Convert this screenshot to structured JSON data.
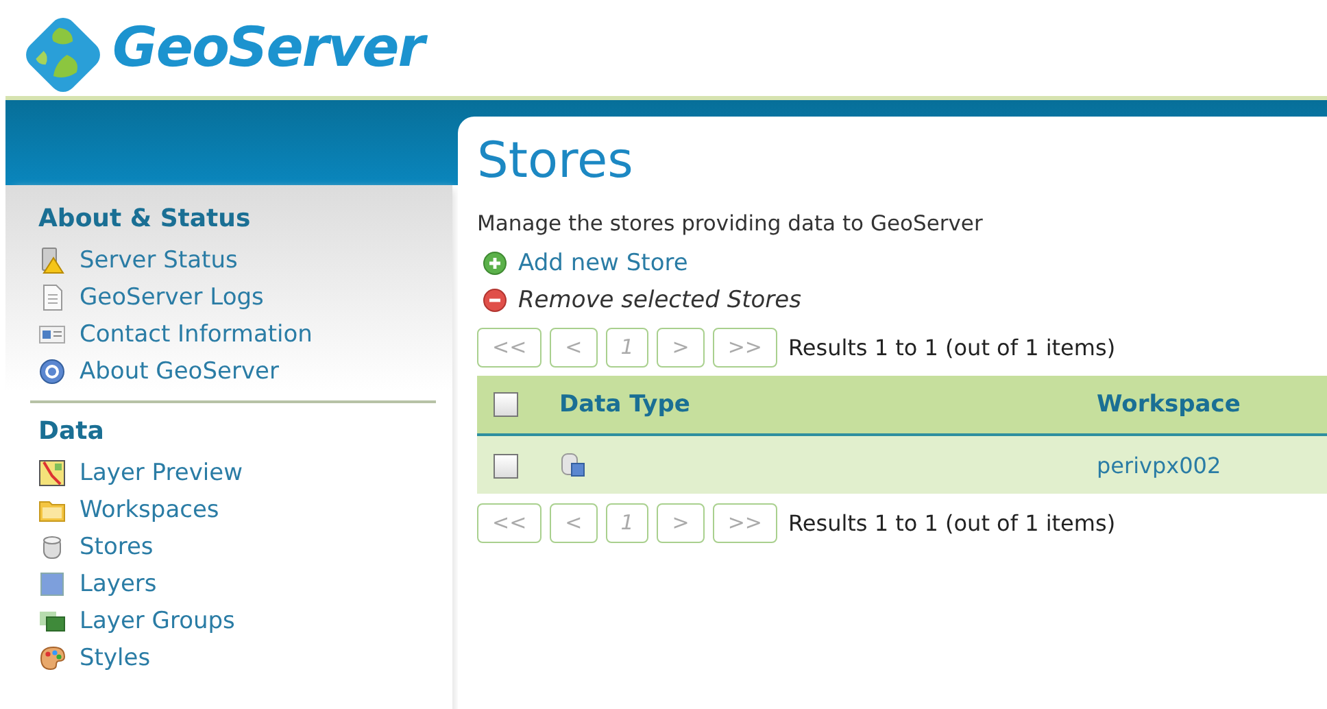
{
  "logo": {
    "title": "GeoServer"
  },
  "sidebar": {
    "sections": [
      {
        "title": "About & Status",
        "items": [
          {
            "label": "Server Status"
          },
          {
            "label": "GeoServer Logs"
          },
          {
            "label": "Contact Information"
          },
          {
            "label": "About GeoServer"
          }
        ]
      },
      {
        "title": "Data",
        "items": [
          {
            "label": "Layer Preview"
          },
          {
            "label": "Workspaces"
          },
          {
            "label": "Stores"
          },
          {
            "label": "Layers"
          },
          {
            "label": "Layer Groups"
          },
          {
            "label": "Styles"
          }
        ]
      }
    ]
  },
  "page": {
    "title": "Stores",
    "description": "Manage the stores providing data to GeoServer",
    "actions": [
      {
        "kind": "add",
        "label": "Add new Store",
        "disabled": false
      },
      {
        "kind": "remove",
        "label": "Remove selected Stores",
        "disabled": true
      }
    ],
    "pager_top": {
      "buttons": [
        {
          "label": "<<",
          "disabled": true
        },
        {
          "label": "<",
          "disabled": true
        },
        {
          "label": "1",
          "disabled": true
        },
        {
          "label": ">",
          "disabled": true
        },
        {
          "label": ">>",
          "disabled": true
        }
      ],
      "summary": "Results 1 to 1 (out of 1 items)"
    },
    "table": {
      "select_all": {
        "checked": false
      },
      "columns": [
        "Data Type",
        "Workspace"
      ],
      "rows": [
        {
          "checked": false,
          "workspace": "perivpx002"
        }
      ]
    },
    "pager_bottom": {
      "buttons": [
        {
          "label": "<<",
          "disabled": true
        },
        {
          "label": "<",
          "disabled": true
        },
        {
          "label": "1",
          "disabled": true
        },
        {
          "label": ">",
          "disabled": true
        },
        {
          "label": ">>",
          "disabled": true
        }
      ],
      "summary": "Results 1 to 1 (out of 1 items)"
    }
  }
}
